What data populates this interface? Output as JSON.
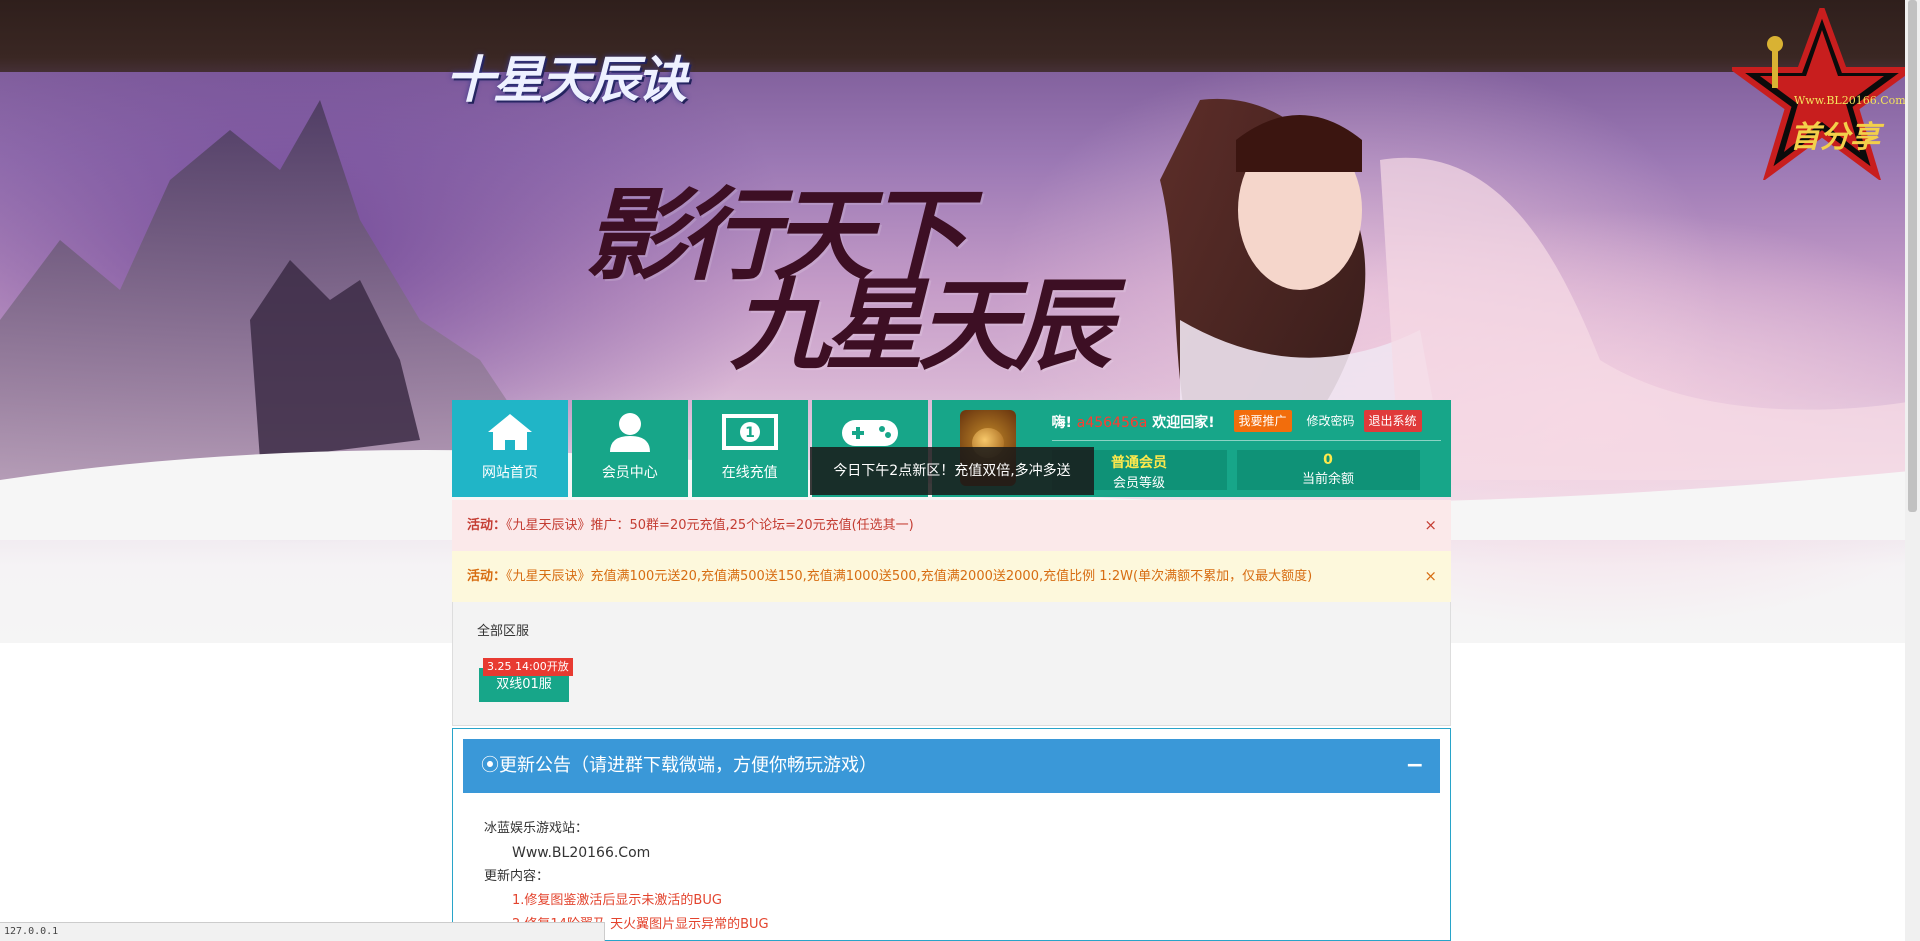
{
  "hero": {
    "logo_text": "十星天辰诀",
    "slogan_line1": "影行天下",
    "slogan_line2": "九星天辰",
    "badge_url": "Www.BL20166.Com",
    "badge_name": "首分享"
  },
  "nav": {
    "items": [
      {
        "label": "网站首页",
        "icon": "home-icon"
      },
      {
        "label": "会员中心",
        "icon": "user-icon"
      },
      {
        "label": "在线充值",
        "icon": "money-icon"
      },
      {
        "label": "",
        "icon": "gamepad-icon"
      }
    ],
    "tooltip": "今日下午2点新区！充值双倍,多冲多送"
  },
  "user_panel": {
    "greeting": "嗨!",
    "username": "a456456a",
    "welcome": "欢迎回家!",
    "promote_label": "我要推广",
    "change_password_label": "修改密码",
    "logout_label": "退出系统",
    "level_value": "普通会员",
    "level_label": "会员等级",
    "balance_value": "0",
    "balance_label": "当前余额"
  },
  "notices": [
    {
      "tag": "活动：",
      "text": "《九星天辰诀》推广：50群=20元充值,25个论坛=20元充值(任选其一)",
      "close": "×"
    },
    {
      "tag": "活动：",
      "text": "《九星天辰诀》充值满100元送20,充值满500送150,充值满1000送500,充值满2000送2000,充值比例 1:2W(单次满额不累加，仅最大额度)",
      "close": "×"
    }
  ],
  "servers": {
    "title": "全部区服",
    "items": [
      {
        "name": "双线01服",
        "tag": "3.25 14:00开放"
      }
    ]
  },
  "announcement": {
    "title": "⦿更新公告（请进群下载微端，方便你畅玩游戏）",
    "collapse": "−",
    "site_label": "冰蓝娱乐游戏站：",
    "site_url": "Www.BL20166.Com",
    "update_label": "更新内容：",
    "updates": [
      "1.修复图鉴激活后显示未激活的BUG",
      "2.修复14阶翼乃 天火翼图片显示异常的BUG"
    ]
  },
  "status": {
    "url": "127.0.0.1"
  },
  "colors": {
    "teal": "#17a689",
    "cyan_active": "#20b5c7",
    "blue_header": "#3a98d8",
    "red": "#e03a3a",
    "orange": "#f26d0c"
  }
}
